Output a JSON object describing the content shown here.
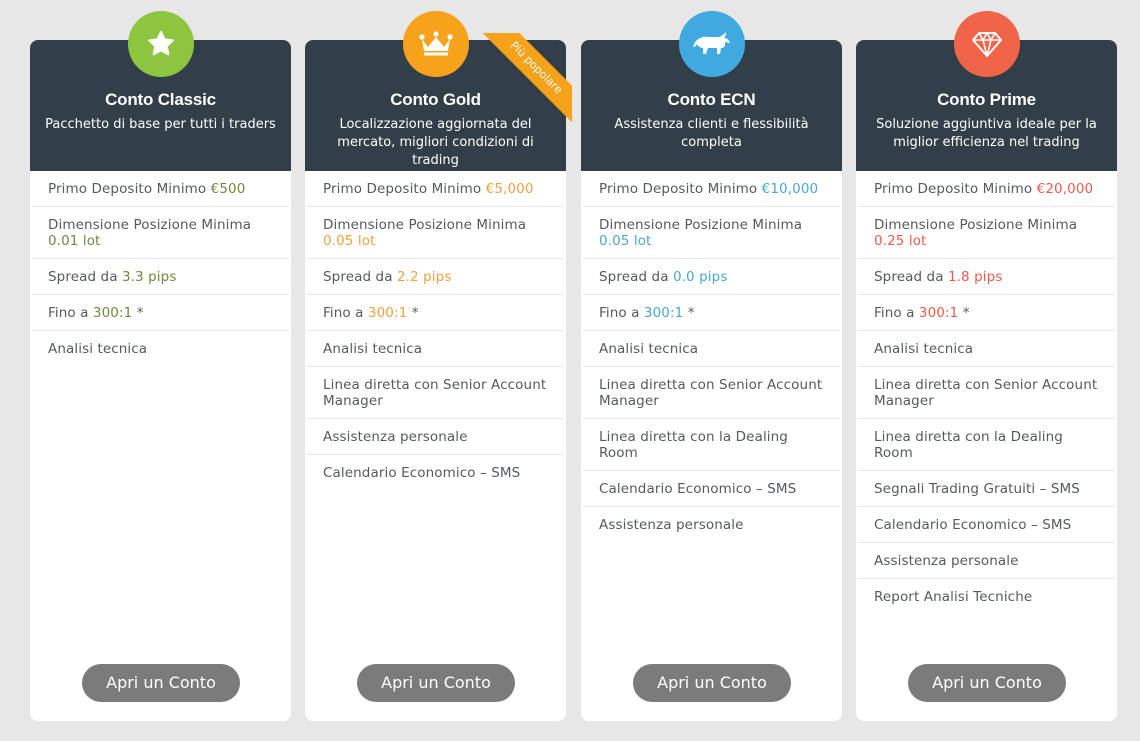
{
  "colors": {
    "page_bg": "#e7e7e7",
    "header_bg": "#323f48",
    "button_bg": "#7b7b7b",
    "classic": "#8cc63f",
    "gold": "#f7a21b",
    "ecn": "#3fa9e0",
    "prime": "#f06449"
  },
  "ribbon": {
    "label": "Più popolare"
  },
  "plans": [
    {
      "id": "classic",
      "icon": "star-icon",
      "accent": "#8cc63f",
      "text_accent": "#6d8a3e",
      "name": "Conto Classic",
      "subtitle": "Pacchetto di base per tutti i traders",
      "features": [
        {
          "text": "Primo Deposito Minimo ",
          "value": "€500"
        },
        {
          "text": "Dimensione Posizione Minima ",
          "value": "0.01 lot"
        },
        {
          "text": "Spread da ",
          "value": "3.3 pips"
        },
        {
          "text": "Fino a ",
          "value": "300:1",
          "suffix": " *"
        },
        {
          "text": "Analisi tecnica"
        }
      ],
      "cta": "Apri un Conto"
    },
    {
      "id": "gold",
      "icon": "crown-icon",
      "accent": "#f7a21b",
      "text_accent": "#f0a040",
      "name": "Conto Gold",
      "subtitle": "Localizzazione aggiornata del mercato, migliori condizioni di trading",
      "features": [
        {
          "text": "Primo Deposito Minimo ",
          "value": "€5,000"
        },
        {
          "text": "Dimensione Posizione Minima ",
          "value": "0.05 lot"
        },
        {
          "text": "Spread da ",
          "value": "2.2 pips"
        },
        {
          "text": "Fino a ",
          "value": "300:1",
          "suffix": " *"
        },
        {
          "text": "Analisi tecnica"
        },
        {
          "text": "Linea diretta con Senior Account Manager"
        },
        {
          "text": "Assistenza personale"
        },
        {
          "text": "Calendario Economico – SMS"
        }
      ],
      "cta": "Apri un Conto"
    },
    {
      "id": "ecn",
      "icon": "bull-icon",
      "accent": "#3fa9e0",
      "text_accent": "#4aa7d8",
      "name": "Conto ECN",
      "subtitle": "Assistenza clienti e flessibilità completa",
      "features": [
        {
          "text": "Primo Deposito Minimo ",
          "value": "€10,000"
        },
        {
          "text": "Dimensione Posizione Minima ",
          "value": "0.05 lot"
        },
        {
          "text": "Spread da ",
          "value": "0.0 pips"
        },
        {
          "text": "Fino a ",
          "value": "300:1",
          "suffix": " *"
        },
        {
          "text": "Analisi tecnica"
        },
        {
          "text": "Linea diretta con Senior Account Manager"
        },
        {
          "text": "Linea diretta con la Dealing Room"
        },
        {
          "text": "Calendario Economico – SMS"
        },
        {
          "text": "Assistenza personale"
        }
      ],
      "cta": "Apri un Conto"
    },
    {
      "id": "prime",
      "icon": "diamond-icon",
      "accent": "#f06449",
      "text_accent": "#ef5a4a",
      "name": "Conto Prime",
      "subtitle": "Soluzione aggiuntiva ideale per la miglior efficienza nel trading",
      "features": [
        {
          "text": "Primo Deposito Minimo ",
          "value": "€20,000"
        },
        {
          "text": "Dimensione Posizione Minima ",
          "value": "0.25 lot"
        },
        {
          "text": "Spread da ",
          "value": "1.8 pips"
        },
        {
          "text": "Fino a ",
          "value": "300:1",
          "suffix": " *"
        },
        {
          "text": "Analisi tecnica"
        },
        {
          "text": "Linea diretta con Senior Account Manager"
        },
        {
          "text": "Linea diretta con la Dealing Room"
        },
        {
          "text": "Segnali Trading Gratuiti – SMS"
        },
        {
          "text": "Calendario Economico – SMS"
        },
        {
          "text": "Assistenza personale"
        },
        {
          "text": "Report Analisi Tecniche"
        }
      ],
      "cta": "Apri un Conto"
    }
  ]
}
